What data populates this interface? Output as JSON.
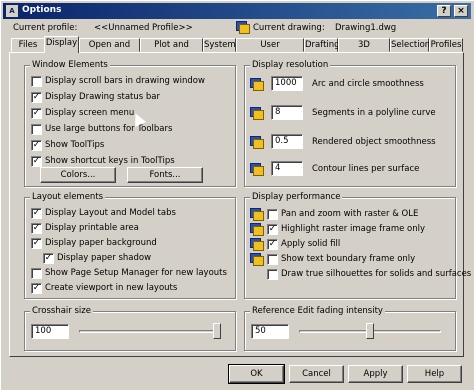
{
  "window": {
    "title": "Options",
    "help_glyph": "?",
    "close_glyph": "×",
    "app_glyph": "A"
  },
  "profile": {
    "label": "Current profile:",
    "value": "<<Unnamed Profile>>"
  },
  "drawing": {
    "label": "Current drawing:",
    "value": "Drawing1.dwg"
  },
  "tabs": [
    "Files",
    "Display",
    "Open and Save",
    "Plot and Publish",
    "System",
    "User Preferences",
    "Drafting",
    "3D Modeling",
    "Selection",
    "Profiles"
  ],
  "active_tab": "Display",
  "window_elements": {
    "title": "Window Elements",
    "items": [
      {
        "label": "Display scroll bars in drawing window",
        "checked": false
      },
      {
        "label": "Display Drawing status bar",
        "checked": true
      },
      {
        "label": "Display screen menu",
        "checked": true
      },
      {
        "label": "Use large buttons for Toolbars",
        "checked": false
      },
      {
        "label": "Show ToolTips",
        "checked": true
      },
      {
        "label": "Show shortcut keys in ToolTips",
        "checked": true
      }
    ],
    "colors_button": "Colors...",
    "fonts_button": "Fonts..."
  },
  "display_resolution": {
    "title": "Display resolution",
    "items": [
      {
        "value": "1000",
        "label": "Arc and circle smoothness"
      },
      {
        "value": "8",
        "label": "Segments in a polyline curve"
      },
      {
        "value": "0.5",
        "label": "Rendered object smoothness"
      },
      {
        "value": "4",
        "label": "Contour lines per surface"
      }
    ]
  },
  "layout_elements": {
    "title": "Layout elements",
    "items": [
      {
        "label": "Display Layout and Model tabs",
        "checked": true
      },
      {
        "label": "Display printable area",
        "checked": true
      },
      {
        "label": "Display paper background",
        "checked": true
      },
      {
        "label": "Display paper shadow",
        "checked": true
      },
      {
        "label": "Show Page Setup Manager for new layouts",
        "checked": false
      },
      {
        "label": "Create viewport in new layouts",
        "checked": true
      }
    ]
  },
  "display_performance": {
    "title": "Display performance",
    "items": [
      {
        "label": "Pan and zoom with raster & OLE",
        "checked": false
      },
      {
        "label": "Highlight raster image frame only",
        "checked": true
      },
      {
        "label": "Apply solid fill",
        "checked": true
      },
      {
        "label": "Show text boundary frame only",
        "checked": false
      },
      {
        "label": "Draw true silhouettes for solids and surfaces",
        "checked": false
      }
    ]
  },
  "crosshair": {
    "title": "Crosshair size",
    "value": "100",
    "level": 1.0
  },
  "xref_fading": {
    "title": "Reference Edit fading intensity",
    "value": "50",
    "level": 0.5
  },
  "buttons": {
    "ok": "OK",
    "cancel": "Cancel",
    "apply": "Apply",
    "help": "Help"
  },
  "check_glyph": "✓"
}
